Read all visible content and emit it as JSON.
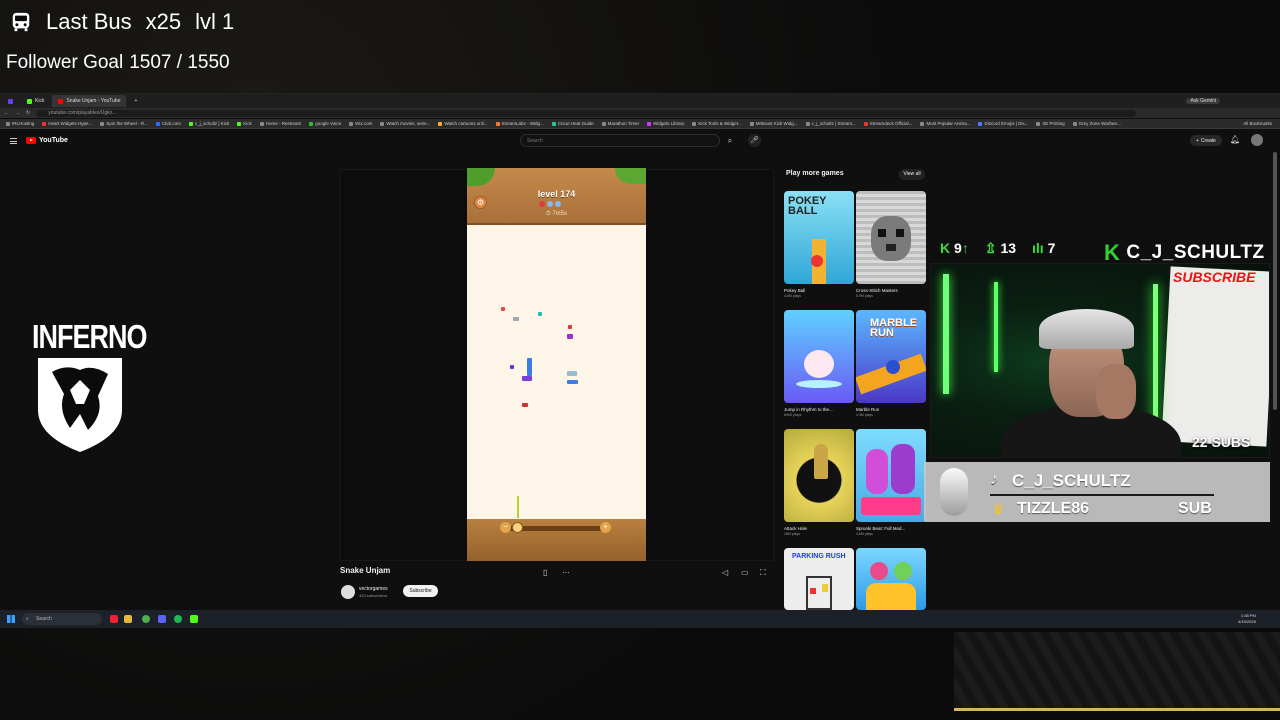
{
  "overlay": {
    "bus_label": "Last Bus",
    "bus_multiplier": "x25",
    "bus_level": "lvl 1",
    "follower_goal_label": "Follower Goal",
    "follower_goal_value": "1507 / 1550"
  },
  "browser": {
    "tabs": [
      {
        "label": "",
        "color": "#53fc18"
      },
      {
        "label": "Kick",
        "color": "#53fc18"
      },
      {
        "label": "Snake Unjam - YouTube",
        "color": "#ff0000",
        "active": true
      }
    ],
    "url": "youtube.com/playables/Ugkx...",
    "ask_gemini": "Ask Gemini",
    "bookmarks": [
      "IRLHosting",
      "Heart Widgets Hype...",
      "Spin the Wheel - R...",
      "Club.com",
      "c_j_schultz | Kick",
      "Kick",
      "Home - Restream",
      "google Voice",
      "Wix.com",
      "Watch movies, serie...",
      "Watch cartoons onli...",
      "StreamLabs - Widg...",
      "Cricut Heat Guide",
      "Marathon Timer",
      "Widgets Library",
      "Kick Tools & Widget...",
      "MrBoost Kick Widg...",
      "c_j_schultz | Stream...",
      "Streamdeck Official...",
      "Most Popular Anima...",
      "Discord Emojis | Dis...",
      "3D Printing",
      "Grey Zone Warfare..."
    ],
    "all_bookmarks": "All Bookmarks"
  },
  "youtube": {
    "logo_text": "YouTube",
    "search_placeholder": "Search",
    "create_label": "Create",
    "video_title": "Snake Unjam",
    "channel_name": "vectorgames",
    "channel_subs": "420 subscribers",
    "subscribe_label": "Subscribe",
    "more_games_title": "Play more games",
    "view_all_label": "View all",
    "games": [
      {
        "name": "Pokey Ball",
        "plays": "4.6M plays",
        "thumb_text": "POKEY BALL",
        "bg": "#3dbbe0"
      },
      {
        "name": "Cross-Stitch Masters",
        "plays": "5.9M plays",
        "thumb_text": "",
        "bg": "#c9c9c9"
      },
      {
        "name": "Jump in Rhythm to the...",
        "plays": "690K plays",
        "thumb_text": "",
        "bg": "#4f8ef0"
      },
      {
        "name": "Marble Run",
        "plays": "4.3M plays",
        "thumb_text": "MARBLE RUN",
        "bg": "#6a4fd8"
      },
      {
        "name": "Attack Hole",
        "plays": "18M plays",
        "thumb_text": "",
        "bg": "#d2c33d"
      },
      {
        "name": "Sprunki Beat: Full Mod...",
        "plays": "4.6M plays",
        "thumb_text": "",
        "bg": "#6ad0ff"
      },
      {
        "name": "",
        "plays": "",
        "thumb_text": "PARKING RUSH",
        "bg": "#f3f3f3"
      },
      {
        "name": "",
        "plays": "",
        "thumb_text": "",
        "bg": "#ffd233"
      }
    ]
  },
  "game": {
    "level_text": "level 174",
    "timer_text": "7m5s",
    "zoom_minus": "−",
    "zoom_plus": "+",
    "gear": "⚙"
  },
  "taskbar": {
    "search_placeholder": "Search",
    "clock_time": "1:38 PM",
    "clock_date": "4/15/2025"
  },
  "stream": {
    "kick_follows": "9",
    "viewers": "13",
    "chatters": "7",
    "streamer_name": "C_J_SCHULTZ",
    "subs_count": "22 SUBS",
    "tiktok_name": "C_J_SCHULTZ",
    "latest_sub_name": "TIZZLE86",
    "sub_label": "SUB",
    "whiteboard_text": "SUBSCRIBE",
    "logo_text": "INFERNO"
  },
  "colors": {
    "kick_green": "#53fc18",
    "youtube_red": "#ff0000",
    "gold": "#d6b46a"
  }
}
